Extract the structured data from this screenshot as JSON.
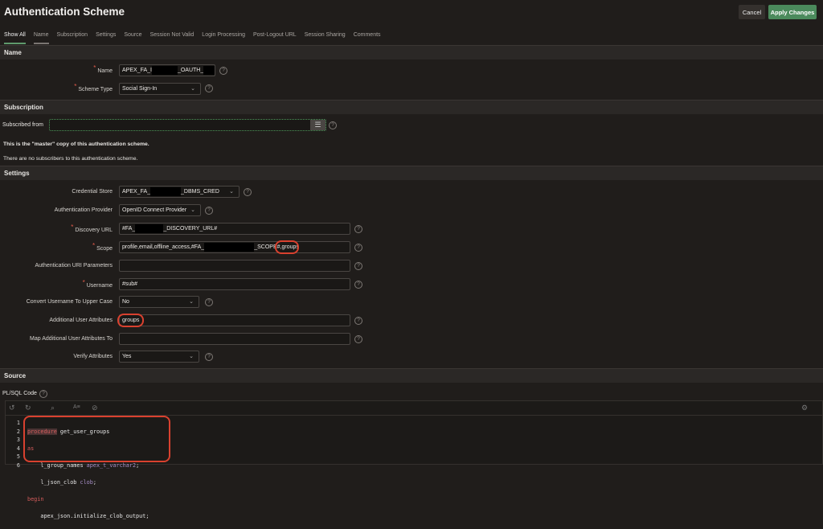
{
  "header": {
    "title": "Authentication Scheme",
    "cancel": "Cancel",
    "apply": "Apply Changes"
  },
  "tabs": [
    "Show All",
    "Name",
    "Subscription",
    "Settings",
    "Source",
    "Session Not Valid",
    "Login Processing",
    "Post-Logout URL",
    "Session Sharing",
    "Comments"
  ],
  "sections": {
    "name": "Name",
    "subscription": "Subscription",
    "settings": "Settings",
    "source": "Source"
  },
  "name_section": {
    "name_label": "Name",
    "name_pre": "APEX_FA_I",
    "name_mid": "_OAUTH_",
    "name_post": ".",
    "scheme_type_label": "Scheme Type",
    "scheme_type": "Social Sign-In"
  },
  "subscription": {
    "subscribed_from_label": "Subscribed from",
    "subscribed_from": "",
    "master_note": "This is the \"master\" copy of this authentication scheme.",
    "subscribers_note": "There are no subscribers to this authentication scheme."
  },
  "settings": {
    "credential_store_label": "Credential Store",
    "credential_store_pre": "APEX_FA_",
    "credential_store_post": "_DBMS_CRED",
    "auth_provider_label": "Authentication Provider",
    "auth_provider": "OpenID Connect Provider",
    "discovery_url_label": "Discovery URL",
    "discovery_url_pre": "#FA_",
    "discovery_url_post": "_DISCOVERY_URL#",
    "scope_label": "Scope",
    "scope_pre": "profile,email,offline_access,#FA_",
    "scope_post": "_SCOPE#,",
    "scope_highlight": "groups",
    "auth_uri_params_label": "Authentication URI Parameters",
    "auth_uri_params": "",
    "username_label": "Username",
    "username": "#sub#",
    "convert_upper_label": "Convert Username To Upper Case",
    "convert_upper": "No",
    "additional_attrs_label": "Additional User Attributes",
    "additional_attrs": "groups",
    "map_attrs_label": "Map Additional User Attributes To",
    "map_attrs": "",
    "verify_attrs_label": "Verify Attributes",
    "verify_attrs": "Yes"
  },
  "source": {
    "plsql_label": "PL/SQL Code",
    "code": [
      {
        "n": "1"
      },
      {
        "n": "2"
      },
      {
        "n": "3"
      },
      {
        "n": "4"
      },
      {
        "n": "5"
      },
      {
        "n": "6"
      }
    ],
    "l1_kw": "procedure",
    "l1_rest": " get_user_groups",
    "l2_kw": "as",
    "l3_a": "    l_group_names ",
    "l3_ty": "apex_t_varchar2",
    "l3_b": ";",
    "l4_a": "    l_json_clob ",
    "l4_ty": "clob",
    "l4_b": ";",
    "l5_kw": "begin",
    "l6": "    apex_json.initialize_clob_output;"
  },
  "colors": {
    "accent": "#4b8a5c",
    "required": "#e05a4a",
    "annotation": "#d9412f"
  }
}
